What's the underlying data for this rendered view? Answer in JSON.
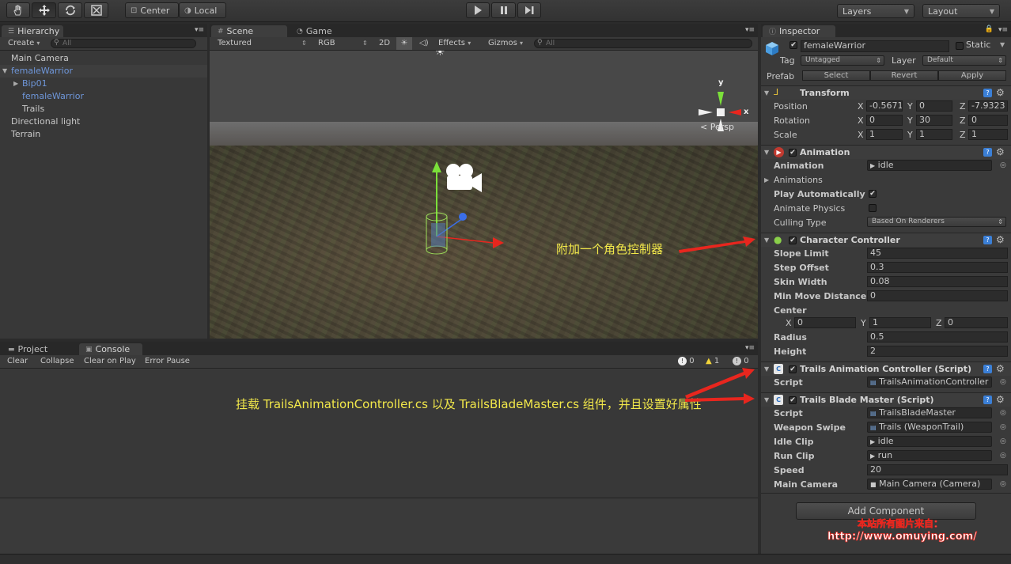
{
  "toolbar": {
    "pivot_center": "Center",
    "pivot_local": "Local",
    "layers": "Layers",
    "layout": "Layout"
  },
  "hierarchy": {
    "tab": "Hierarchy",
    "create": "Create",
    "search_placeholder": "All",
    "items": [
      {
        "label": "Main Camera"
      },
      {
        "label": "femaleWarrior"
      },
      {
        "label": "Bip01"
      },
      {
        "label": "femaleWarrior"
      },
      {
        "label": "Trails"
      },
      {
        "label": "Directional light"
      },
      {
        "label": "Terrain"
      }
    ]
  },
  "scene": {
    "tab_scene": "Scene",
    "tab_game": "Game",
    "shading": "Textured",
    "render_mode": "RGB",
    "mode_2d": "2D",
    "effects": "Effects",
    "gizmos": "Gizmos",
    "search_placeholder": "All",
    "gizmo_y": "y",
    "gizmo_x": "x",
    "persp": "Persp",
    "annotation": "附加一个角色控制器"
  },
  "console": {
    "tab_project": "Project",
    "tab_console": "Console",
    "clear": "Clear",
    "collapse": "Collapse",
    "clear_on_play": "Clear on Play",
    "error_pause": "Error Pause",
    "count_info": "0",
    "count_warn": "1",
    "count_error": "0",
    "annotation": "挂载 TrailsAnimationController.cs 以及 TrailsBladeMaster.cs 组件，并且设置好属性"
  },
  "inspector": {
    "tab": "Inspector",
    "object_name": "femaleWarrior",
    "static": "Static",
    "tag_label": "Tag",
    "tag_value": "Untagged",
    "layer_label": "Layer",
    "layer_value": "Default",
    "prefab_label": "Prefab",
    "prefab_select": "Select",
    "prefab_revert": "Revert",
    "prefab_apply": "Apply",
    "transform": {
      "title": "Transform",
      "position": "Position",
      "pos_x": "-0.5671",
      "pos_y": "0",
      "pos_z": "-7.9323",
      "rotation": "Rotation",
      "rot_x": "0",
      "rot_y": "30",
      "rot_z": "0",
      "scale": "Scale",
      "scl_x": "1",
      "scl_y": "1",
      "scl_z": "1",
      "x": "X",
      "y": "Y",
      "z": "Z"
    },
    "animation": {
      "title": "Animation",
      "animation_label": "Animation",
      "animation_value": "idle",
      "animations_label": "Animations",
      "play_auto": "Play Automatically",
      "animate_physics": "Animate Physics",
      "culling_label": "Culling Type",
      "culling_value": "Based On Renderers"
    },
    "character_controller": {
      "title": "Character Controller",
      "slope_label": "Slope Limit",
      "slope": "45",
      "step_label": "Step Offset",
      "step": "0.3",
      "skin_label": "Skin Width",
      "skin": "0.08",
      "minmove_label": "Min Move Distance",
      "minmove": "0",
      "center_label": "Center",
      "cx": "0",
      "cy": "1",
      "cz": "0",
      "radius_label": "Radius",
      "radius": "0.5",
      "height_label": "Height",
      "height": "2"
    },
    "trails_anim": {
      "title": "Trails Animation Controller (Script)",
      "script_label": "Script",
      "script": "TrailsAnimationController"
    },
    "trails_blade": {
      "title": "Trails Blade Master (Script)",
      "script_label": "Script",
      "script": "TrailsBladeMaster",
      "swipe_label": "Weapon Swipe",
      "swipe": "Trails (WeaponTrail)",
      "idle_label": "Idle Clip",
      "idle": "idle",
      "run_label": "Run Clip",
      "run": "run",
      "speed_label": "Speed",
      "speed": "20",
      "camera_label": "Main Camera",
      "camera": "Main Camera (Camera)"
    },
    "add_component": "Add Component"
  },
  "watermark": {
    "line1": "本站所有图片来自：",
    "line2": "http://www.omuying.com/"
  },
  "colors": {
    "accent_blue": "#6e96d9",
    "annotation_yellow": "#f2e84a",
    "arrow_red": "#e8261e"
  }
}
